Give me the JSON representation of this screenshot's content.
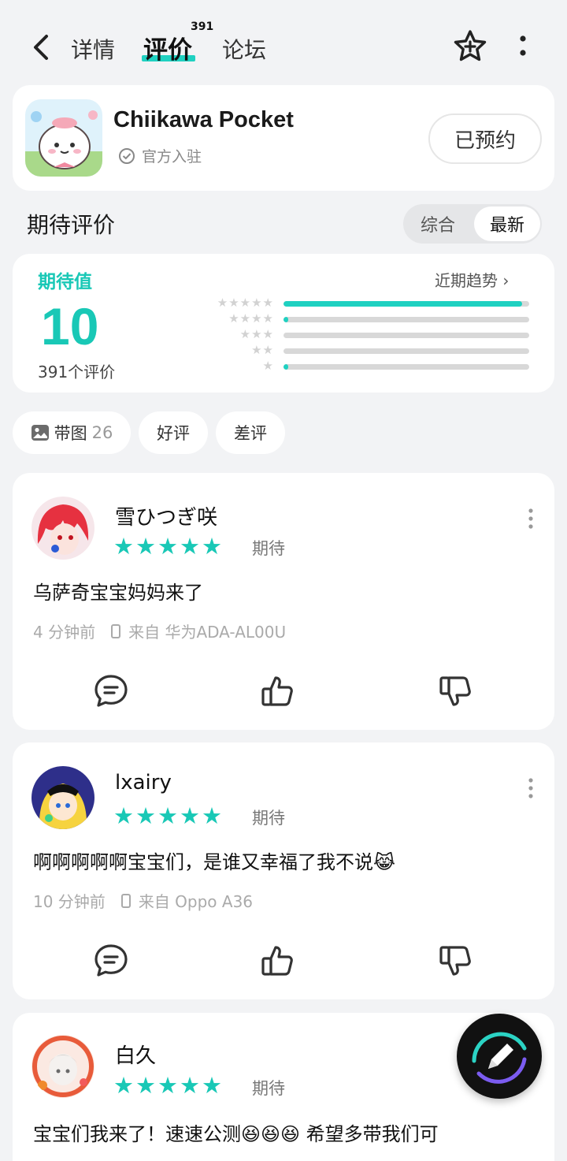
{
  "header": {
    "tab_details": "详情",
    "tab_reviews": "评价",
    "tab_reviews_count": "391",
    "tab_forum": "论坛"
  },
  "app": {
    "name": "Chiikawa Pocket",
    "official_label": "官方入驻",
    "reserve_label": "已预约"
  },
  "section": {
    "title": "期待评价",
    "sort_options": [
      "综合",
      "最新"
    ],
    "sort_selected": "最新"
  },
  "rating": {
    "label": "期待值",
    "value": "10",
    "count_label": "391个评价",
    "trend_label": "近期趋势 ›",
    "distribution": [
      {
        "stars": 5,
        "fraction": 0.97
      },
      {
        "stars": 4,
        "fraction": 0.02
      },
      {
        "stars": 3,
        "fraction": 0.0
      },
      {
        "stars": 2,
        "fraction": 0.0
      },
      {
        "stars": 1,
        "fraction": 0.02
      }
    ]
  },
  "filters": {
    "with_image_label": "带图",
    "with_image_count": "26",
    "good_label": "好评",
    "bad_label": "差评"
  },
  "reviews": [
    {
      "username": "雪ひつぎ咲",
      "stars": "★★★★★",
      "tag": "期待",
      "text": "乌萨奇宝宝妈妈来了",
      "time": "4 分钟前",
      "device": "来自 华为ADA-AL00U"
    },
    {
      "username": "lxairy",
      "stars": "★★★★★",
      "tag": "期待",
      "text": "啊啊啊啊啊宝宝们，是谁又幸福了我不说😹",
      "time": "10 分钟前",
      "device": "来自 Oppo A36"
    },
    {
      "username": "白久",
      "stars": "★★★★★",
      "tag": "期待",
      "text": "宝宝们我来了！速速公测😆😆😆 希望多带我们可"
    }
  ],
  "colors": {
    "accent": "#19c8b6",
    "background": "#f2f3f5"
  }
}
